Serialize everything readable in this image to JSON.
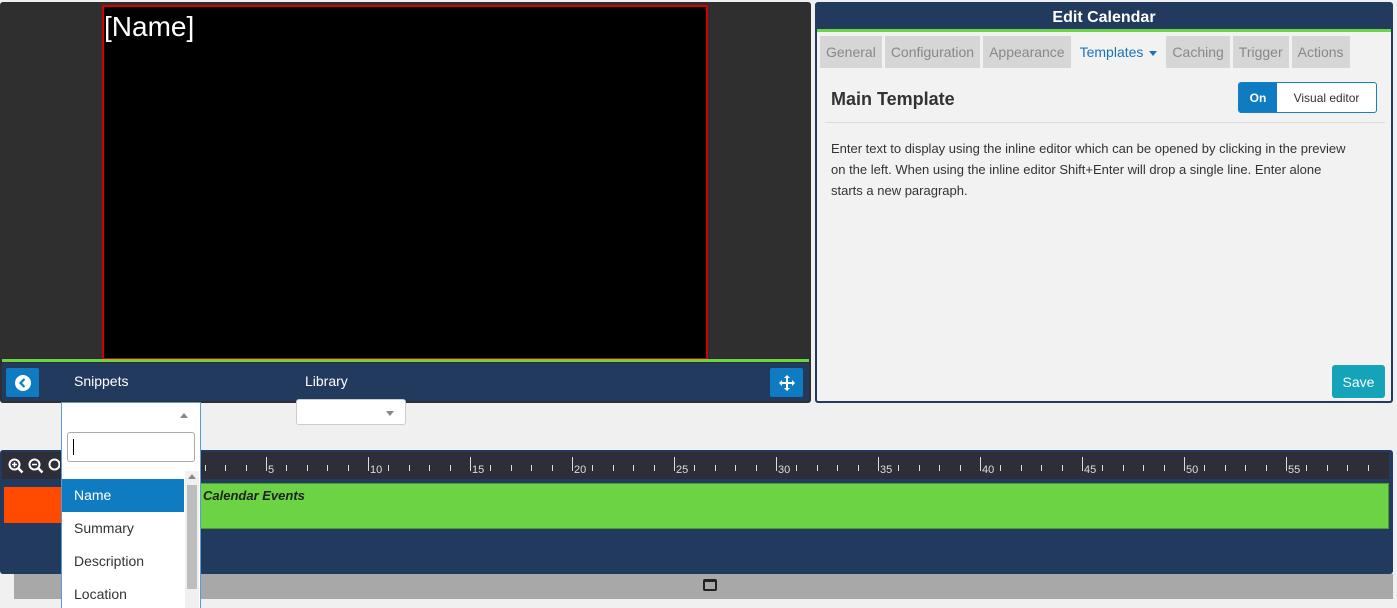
{
  "preview": {
    "placeholder": "[Name]",
    "toolbar": {
      "back_icon": "arrow-left-circle-icon",
      "snippets_label": "Snippets",
      "library_label": "Library",
      "move_icon": "move-arrows-icon"
    }
  },
  "edit_panel": {
    "title": "Edit Calendar",
    "tabs": [
      {
        "label": "General"
      },
      {
        "label": "Configuration"
      },
      {
        "label": "Appearance"
      },
      {
        "label": "Templates",
        "active": true
      },
      {
        "label": "Caching"
      },
      {
        "label": "Trigger"
      },
      {
        "label": "Actions"
      }
    ],
    "section_title": "Main Template",
    "toggle": {
      "on_label": "On",
      "label": "Visual editor"
    },
    "help_text": "Enter text to display using the inline editor which can be opened by clicking in the preview on the left. When using the inline editor Shift+Enter will drop a single line. Enter alone starts a new paragraph.",
    "save_label": "Save"
  },
  "library_select": {
    "value": ""
  },
  "snippets_dropdown": {
    "search_value": "",
    "items": [
      {
        "label": "Name",
        "selected": true
      },
      {
        "label": "Summary"
      },
      {
        "label": "Description"
      },
      {
        "label": "Location"
      }
    ]
  },
  "timeline": {
    "zoom_icons": [
      "zoom-in-icon",
      "zoom-out-icon",
      "zoom-reset-icon"
    ],
    "ruler_labels": [
      "5",
      "10",
      "15",
      "20",
      "25",
      "30",
      "35",
      "40",
      "45",
      "50",
      "55"
    ],
    "track_label": "Calendar Events"
  },
  "colors": {
    "accent_blue": "#0f7cc1",
    "header_navy": "#223a5e",
    "green": "#6bd344",
    "red_track": "#ff4a00",
    "save_teal": "#14a3b8"
  }
}
